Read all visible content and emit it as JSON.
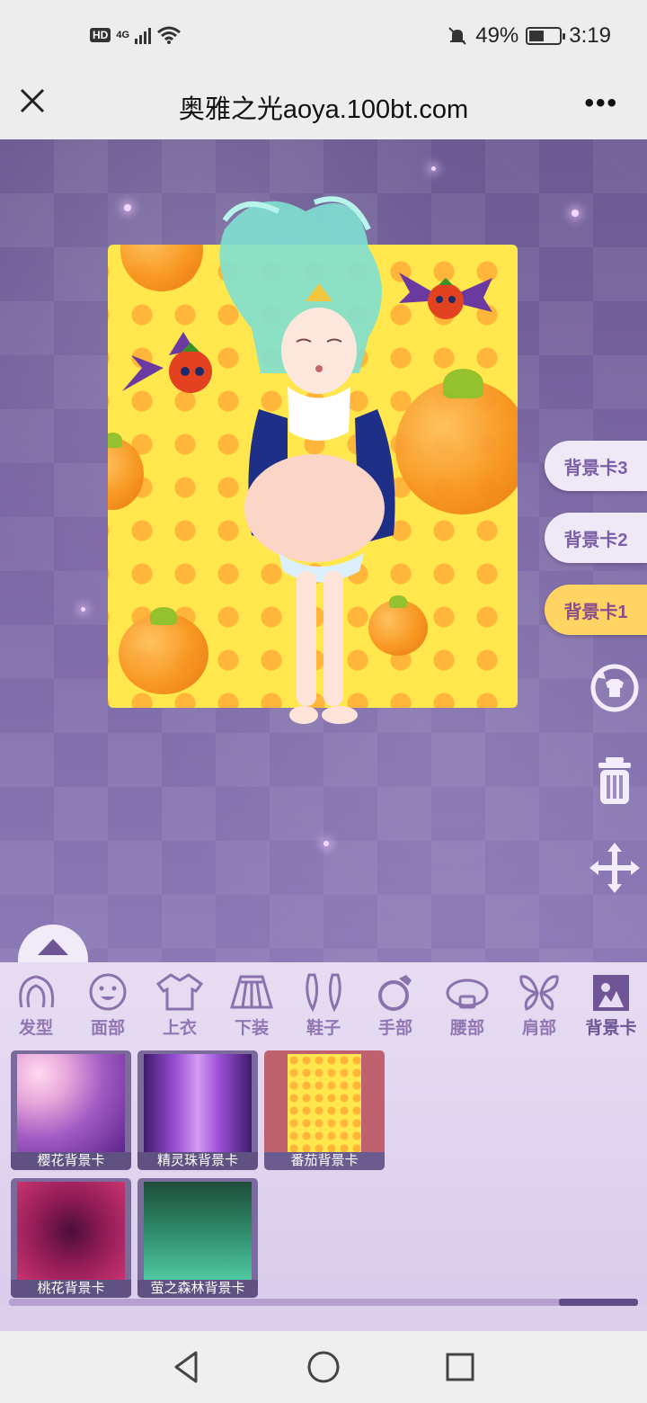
{
  "status_bar": {
    "network_badge": "HD",
    "signal_label": "4G",
    "battery_percent": "49%",
    "battery_level": 0.49,
    "time": "3:19"
  },
  "browser": {
    "title": "奥雅之光aoya.100bt.com",
    "close_icon": "close-icon",
    "more_icon": "more-icon"
  },
  "side_tabs": [
    {
      "label": "背景卡3",
      "active": false
    },
    {
      "label": "背景卡2",
      "active": false
    },
    {
      "label": "背景卡1",
      "active": true
    }
  ],
  "side_icons": [
    "refresh-outfit-icon",
    "trash-icon",
    "move-arrows-icon"
  ],
  "categories": [
    {
      "label": "发型",
      "icon": "hair-icon"
    },
    {
      "label": "面部",
      "icon": "face-icon"
    },
    {
      "label": "上衣",
      "icon": "top-icon"
    },
    {
      "label": "下装",
      "icon": "skirt-icon"
    },
    {
      "label": "鞋子",
      "icon": "shoes-icon"
    },
    {
      "label": "手部",
      "icon": "ring-icon"
    },
    {
      "label": "腰部",
      "icon": "belt-icon"
    },
    {
      "label": "肩部",
      "icon": "wings-icon"
    },
    {
      "label": "背景卡",
      "icon": "background-card-icon",
      "active": true
    }
  ],
  "items": [
    {
      "name": "樱花背景卡"
    },
    {
      "name": "精灵珠背景卡"
    },
    {
      "name": "番茄背景卡",
      "selected": true
    },
    {
      "name": "桃花背景卡"
    },
    {
      "name": "萤之森林背景卡"
    }
  ],
  "colors": {
    "accent_active_tab": "#ffd463",
    "panel": "#e7ddf2",
    "stage": "#7a66a4"
  }
}
